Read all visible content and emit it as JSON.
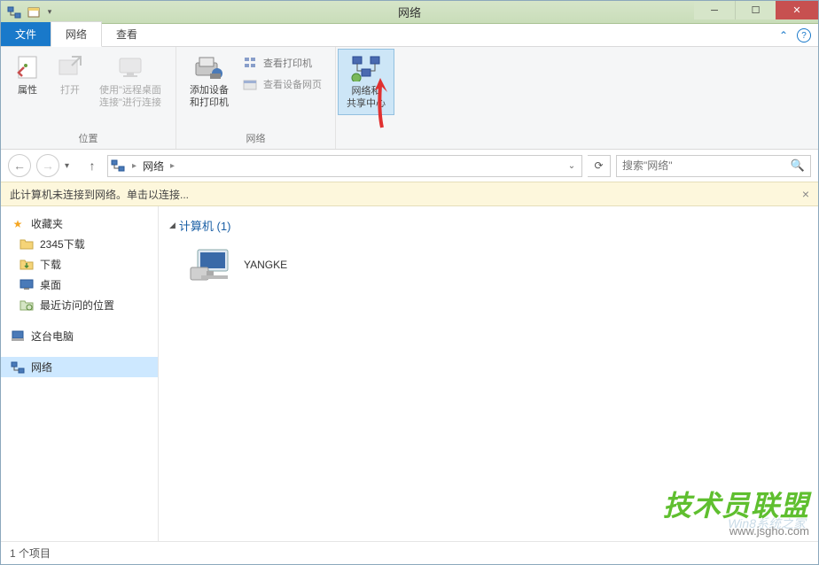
{
  "window": {
    "title": "网络"
  },
  "tabs": {
    "file": "文件",
    "network": "网络",
    "view": "查看"
  },
  "ribbon": {
    "group_location": "位置",
    "group_network": "网络",
    "properties": "属性",
    "open": "打开",
    "remote_desktop": "使用\"远程桌面\n连接\"进行连接",
    "add_devices": "添加设备\n和打印机",
    "view_printers": "查看打印机",
    "view_device_page": "查看设备网页",
    "network_sharing": "网络和\n共享中心"
  },
  "addressbar": {
    "path": "网络"
  },
  "search": {
    "placeholder": "搜索\"网络\""
  },
  "infobar": {
    "message": "此计算机未连接到网络。单击以连接..."
  },
  "sidebar": {
    "favorites": "收藏夹",
    "item_2345": "2345下载",
    "item_downloads": "下载",
    "item_desktop": "桌面",
    "item_recent": "最近访问的位置",
    "this_pc": "这台电脑",
    "network": "网络"
  },
  "content": {
    "group_header": "计算机 (1)",
    "computer_name": "YANGKE"
  },
  "statusbar": {
    "text": "1 个项目"
  },
  "watermark": {
    "main": "技术员联盟",
    "sub": "www.jsgho.com",
    "ghost": "Win8系统之家"
  }
}
